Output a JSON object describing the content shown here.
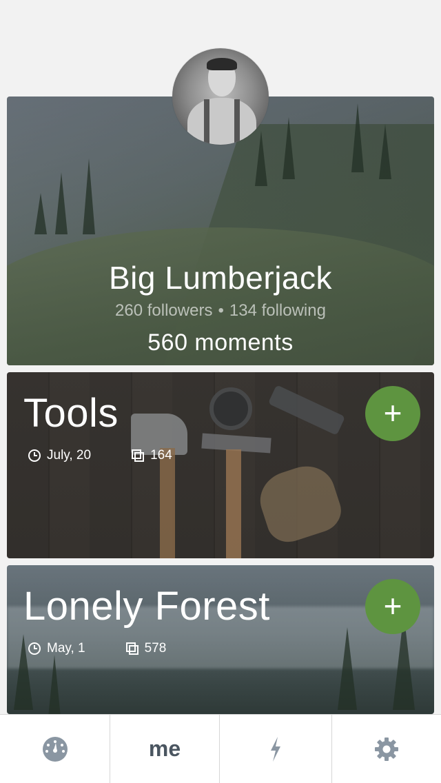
{
  "profile": {
    "name": "Big Lumberjack",
    "followers": "260 followers",
    "separator": "•",
    "following": "134 following",
    "moments": "560 moments"
  },
  "cards": [
    {
      "title": "Tools",
      "date": "July, 20",
      "count": "164",
      "add_label": "+"
    },
    {
      "title": "Lonely Forest",
      "date": "May, 1",
      "count": "578",
      "add_label": "+"
    }
  ],
  "tab_bar": {
    "tabs": [
      {
        "icon": "dashboard-icon"
      },
      {
        "label": "me"
      },
      {
        "icon": "lightning-icon"
      },
      {
        "icon": "gear-icon"
      }
    ]
  },
  "colors": {
    "accent_green": "#5e9440",
    "background": "#f2f2f2",
    "icon_gray": "#8a96a2",
    "tab_text": "#4a5560"
  }
}
